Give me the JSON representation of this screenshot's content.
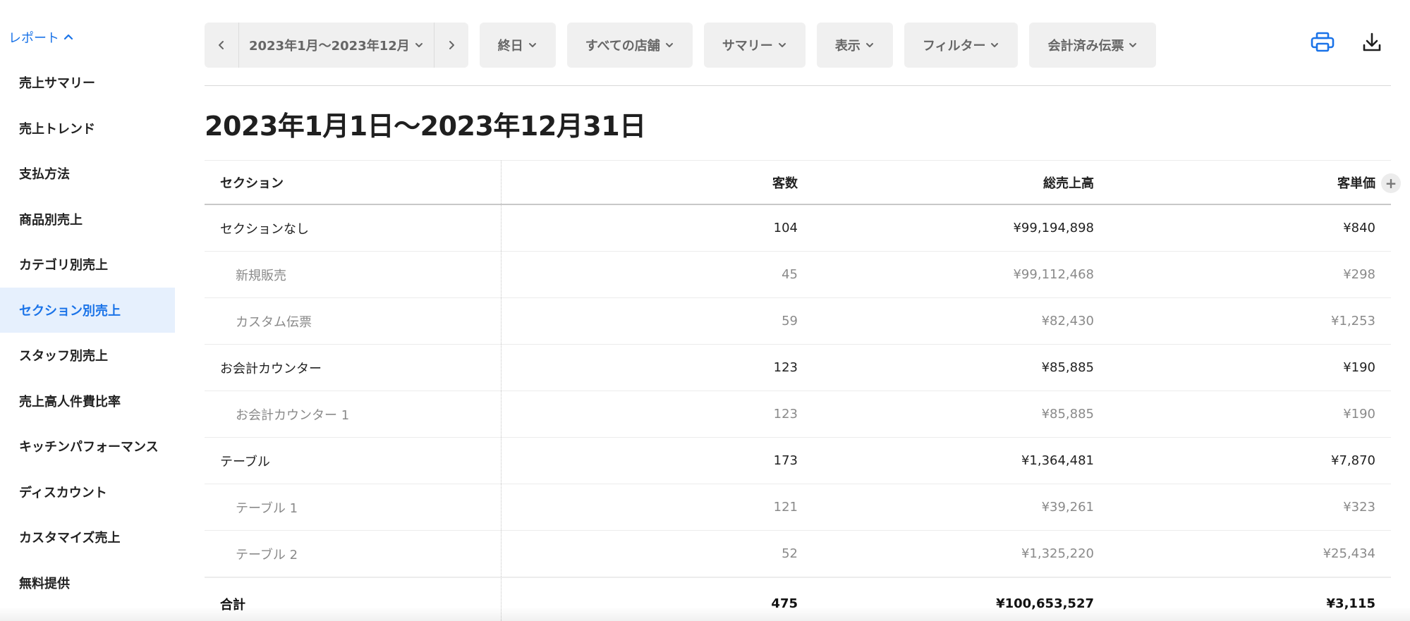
{
  "sidebar": {
    "header_label": "レポート",
    "items": [
      {
        "label": "売上サマリー",
        "active": false
      },
      {
        "label": "売上トレンド",
        "active": false
      },
      {
        "label": "支払方法",
        "active": false
      },
      {
        "label": "商品別売上",
        "active": false
      },
      {
        "label": "カテゴリ別売上",
        "active": false
      },
      {
        "label": "セクション別売上",
        "active": true
      },
      {
        "label": "スタッフ別売上",
        "active": false
      },
      {
        "label": "売上高人件費比率",
        "active": false
      },
      {
        "label": "キッチンパフォーマンス",
        "active": false
      },
      {
        "label": "ディスカウント",
        "active": false
      },
      {
        "label": "カスタマイズ売上",
        "active": false
      },
      {
        "label": "無料提供",
        "active": false
      }
    ]
  },
  "toolbar": {
    "date_range": "2023年1月〜2023年12月",
    "time_filter": "終日",
    "store_filter": "すべての店舗",
    "summary_filter": "サマリー",
    "display_filter": "表示",
    "filter_label": "フィルター",
    "receipt_filter": "会計済み伝票"
  },
  "page": {
    "title": "2023年1月1日〜2023年12月31日"
  },
  "table": {
    "headers": {
      "section": "セクション",
      "guests": "客数",
      "gross_sales": "総売上高",
      "avg_per_guest": "客単価"
    },
    "rows": [
      {
        "level": "parent",
        "section": "セクションなし",
        "guests": "104",
        "gross_sales": "¥99,194,898",
        "avg": "¥840"
      },
      {
        "level": "sub",
        "section": "新規販売",
        "guests": "45",
        "gross_sales": "¥99,112,468",
        "avg": "¥298"
      },
      {
        "level": "sub",
        "section": "カスタム伝票",
        "guests": "59",
        "gross_sales": "¥82,430",
        "avg": "¥1,253"
      },
      {
        "level": "parent",
        "section": "お会計カウンター",
        "guests": "123",
        "gross_sales": "¥85,885",
        "avg": "¥190"
      },
      {
        "level": "sub",
        "section": "お会計カウンター 1",
        "guests": "123",
        "gross_sales": "¥85,885",
        "avg": "¥190"
      },
      {
        "level": "parent",
        "section": "テーブル",
        "guests": "173",
        "gross_sales": "¥1,364,481",
        "avg": "¥7,870"
      },
      {
        "level": "sub",
        "section": "テーブル 1",
        "guests": "121",
        "gross_sales": "¥39,261",
        "avg": "¥323"
      },
      {
        "level": "sub",
        "section": "テーブル 2",
        "guests": "52",
        "gross_sales": "¥1,325,220",
        "avg": "¥25,434"
      }
    ],
    "total": {
      "section": "合計",
      "guests": "475",
      "gross_sales": "¥100,653,527",
      "avg": "¥3,115"
    },
    "add_column_symbol": "+"
  },
  "colors": {
    "accent": "#1a73e8",
    "active_bg": "#e6f0fd",
    "chip_bg": "#f0f0f0"
  },
  "icons": {
    "print": "printer-icon",
    "download": "download-icon"
  }
}
